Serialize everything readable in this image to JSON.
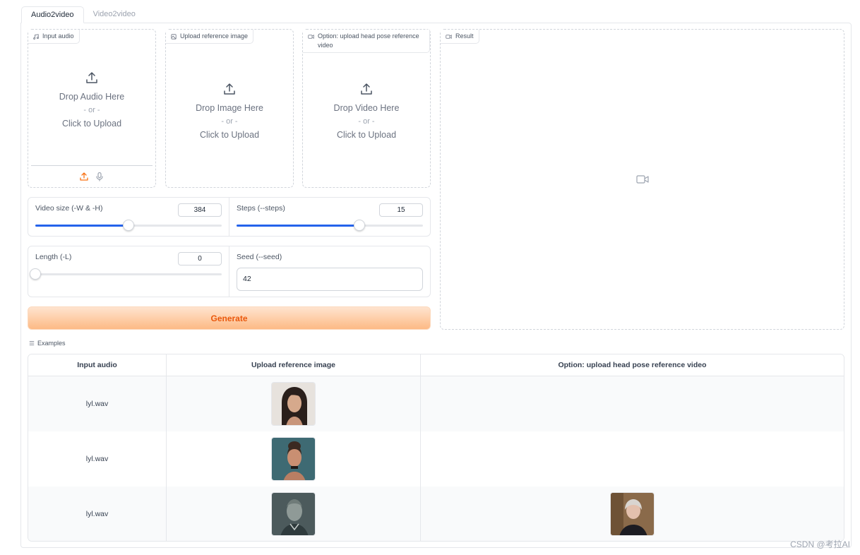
{
  "tabs": [
    {
      "label": "Audio2video",
      "active": true
    },
    {
      "label": "Video2video",
      "active": false
    }
  ],
  "inputs": {
    "audio": {
      "label": "Input audio",
      "drop": "Drop Audio Here",
      "or": "- or -",
      "click": "Click to Upload"
    },
    "image": {
      "label": "Upload reference image",
      "drop": "Drop Image Here",
      "or": "- or -",
      "click": "Click to Upload"
    },
    "video": {
      "label": "Option: upload head pose reference video",
      "drop": "Drop Video Here",
      "or": "- or -",
      "click": "Click to Upload"
    }
  },
  "result": {
    "label": "Result"
  },
  "controls": {
    "video_size": {
      "label": "Video size (-W & -H)",
      "value": "384",
      "fraction": 0.5
    },
    "steps": {
      "label": "Steps (--steps)",
      "value": "15",
      "fraction": 0.66
    },
    "length": {
      "label": "Length (-L)",
      "value": "0",
      "fraction": 0.0
    },
    "seed": {
      "label": "Seed (--seed)",
      "value": "42"
    }
  },
  "generate_label": "Generate",
  "examples": {
    "label": "Examples",
    "columns": [
      "Input audio",
      "Upload reference image",
      "Option: upload head pose reference video"
    ],
    "rows": [
      {
        "audio": "lyl.wav",
        "image": "portrait-young-woman",
        "video": ""
      },
      {
        "audio": "lyl.wav",
        "image": "portrait-woman-updo",
        "video": ""
      },
      {
        "audio": "lyl.wav",
        "image": "portrait-elderly-man",
        "video": "portrait-woman-speaker"
      }
    ]
  },
  "watermark": "CSDN @考拉AI",
  "colors": {
    "accent": "#f97316",
    "slider": "#2563eb"
  }
}
